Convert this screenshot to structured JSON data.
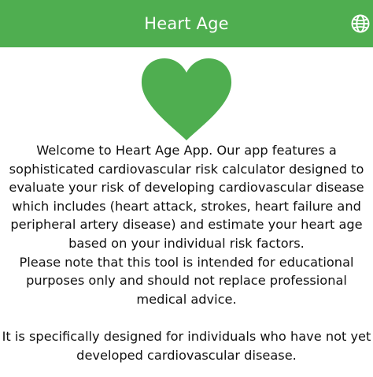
{
  "header": {
    "title": "Heart Age",
    "background_color": "#4fae50",
    "language_icon": "globe-icon"
  },
  "hero": {
    "icon": "heart-icon",
    "color": "#4fae50"
  },
  "content": {
    "welcome_lines": [
      "Welcome to Heart Age App. Our app features a",
      "sophisticated cardiovascular risk calculator designed to",
      "evaluate your risk of developing cardiovascular disease",
      "which includes (heart attack, strokes, heart failure and",
      "peripheral artery disease) and estimate your heart age",
      "based on your individual risk factors."
    ],
    "note_lines": [
      "Please note that this tool is intended for educational",
      "purposes only and should not replace professional",
      "medical advice."
    ],
    "target_lines": [
      "It is specifically designed for individuals who have not yet",
      "developed cardiovascular disease."
    ]
  }
}
